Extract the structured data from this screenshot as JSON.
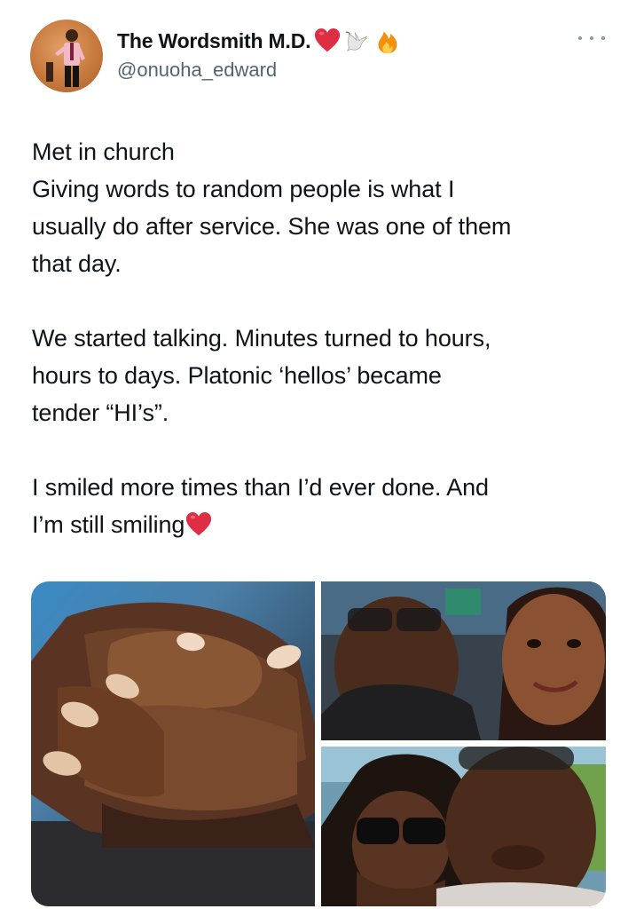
{
  "author": {
    "display_name": "The Wordsmith M.D.",
    "handle": "@onuoha_edward",
    "name_emojis": [
      "red-heart",
      "dove",
      "fire"
    ]
  },
  "tweet": {
    "paragraphs": [
      [
        "Met in church",
        "Giving words to random people is what I",
        "usually do after service. She was one of them",
        "that day."
      ],
      [
        "We started talking. Minutes turned to hours,",
        "hours to days. Platonic ‘hellos’  became",
        "tender  “HI’s”."
      ],
      [
        "I smiled more times than I’d ever done. And",
        "I’m still smiling"
      ]
    ],
    "trailing_emoji": "red-heart"
  },
  "colors": {
    "text": "#0f1419",
    "secondary_text": "#536471",
    "heart": "#e0245e"
  },
  "media": {
    "count": 3,
    "items": [
      {
        "subject": "holding-hands-photo"
      },
      {
        "subject": "couple-selfie-photo"
      },
      {
        "subject": "couple-selfie-sunglasses-photo"
      }
    ]
  }
}
